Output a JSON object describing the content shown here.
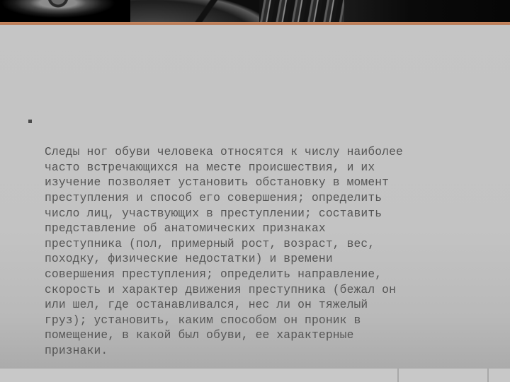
{
  "slide": {
    "header": {
      "image_description": "dark monochrome photographic collage of mechanical parts (wheel, disc, turbine blades)",
      "accent_color": "#c0805a"
    },
    "body": {
      "bullets": [
        {
          "marker": "square-bullet",
          "text": "Следы ног обуви человека относятся к числу наиболее\nчасто встречающихся на месте происшествия, и их\nизучение позволяет установить обстановку в момент\nпреступления и способ его совершения; определить\nчисло лиц, участвующих в преступлении; составить\nпредставление об анатомических признаках\nпреступника (пол, примерный рост, возраст, вес,\nпоходку, физические недостатки) и времени\nсовершения преступления; определить направление,\nскорость и характер движения преступника (бежал он\nили шел, где останавливался, нес ли он тяжелый\nгруз); установить, каким способом он проник в\nпомещение, в какой был обуви, ее характерные\nпризнаки."
        }
      ]
    },
    "colors": {
      "text": "#555555",
      "background": "#c4c4c4",
      "accent": "#c0805a"
    }
  }
}
